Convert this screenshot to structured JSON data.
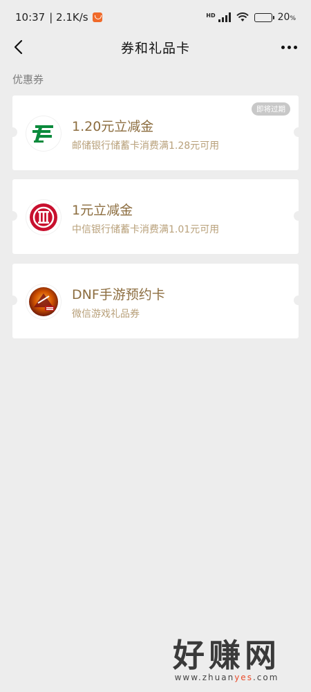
{
  "status_bar": {
    "time": "10:37",
    "speed": "| 2.1K/s",
    "hd": "HD",
    "battery_pct": "20",
    "battery_unit": "%",
    "battery_level": 0.2
  },
  "nav": {
    "title": "券和礼品卡"
  },
  "section": {
    "label": "优惠券"
  },
  "coupons": [
    {
      "title": "1.20元立减金",
      "subtitle": "邮储银行储蓄卡消费满1.28元可用",
      "badge": "即将过期",
      "logo": "postal-savings-bank-logo-icon"
    },
    {
      "title": "1元立减金",
      "subtitle": "中信银行储蓄卡消费满1.01元可用",
      "logo": "citic-bank-logo-icon"
    },
    {
      "title": "DNF手游预约卡",
      "subtitle": "微信游戏礼品券",
      "logo": "dnf-mobile-game-logo-icon"
    }
  ],
  "watermark": {
    "main": "好赚网",
    "url_prefix": "www.zhuan",
    "url_highlight": "yes",
    "url_suffix": ".com"
  },
  "colors": {
    "background": "#ededed",
    "coupon_title": "#8c6d3f",
    "coupon_subtitle": "#b8a07a",
    "postal_green": "#0a8a3c",
    "citic_red": "#c8102e"
  }
}
